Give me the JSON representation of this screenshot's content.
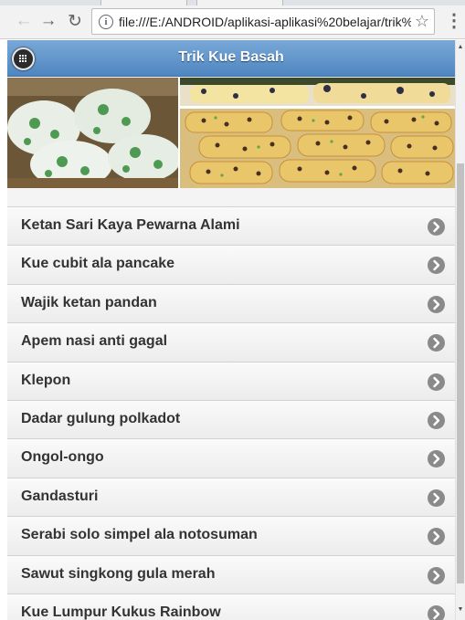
{
  "browser": {
    "url": "file:///E:/ANDROID/aplikasi-aplikasi%20belajar/trik%",
    "back_icon": "←",
    "forward_icon": "→",
    "reload_icon": "↻",
    "info_icon": "i",
    "star_icon": "☆",
    "menu_icon": "⋮"
  },
  "header": {
    "title": "Trik Kue Basah",
    "accent_color": "#5b8fc7"
  },
  "recipes": [
    "Ketan Sari Kaya Pewarna Alami",
    "Kue cubit ala pancake",
    "Wajik ketan pandan",
    "Apem nasi anti gagal",
    "Klepon",
    "Dadar gulung polkadot",
    "Ongol-ongo",
    "Gandasturi",
    "Serabi solo simpel ala notosuman",
    "Sawut singkong gula merah",
    "Kue Lumpur Kukus Rainbow"
  ]
}
